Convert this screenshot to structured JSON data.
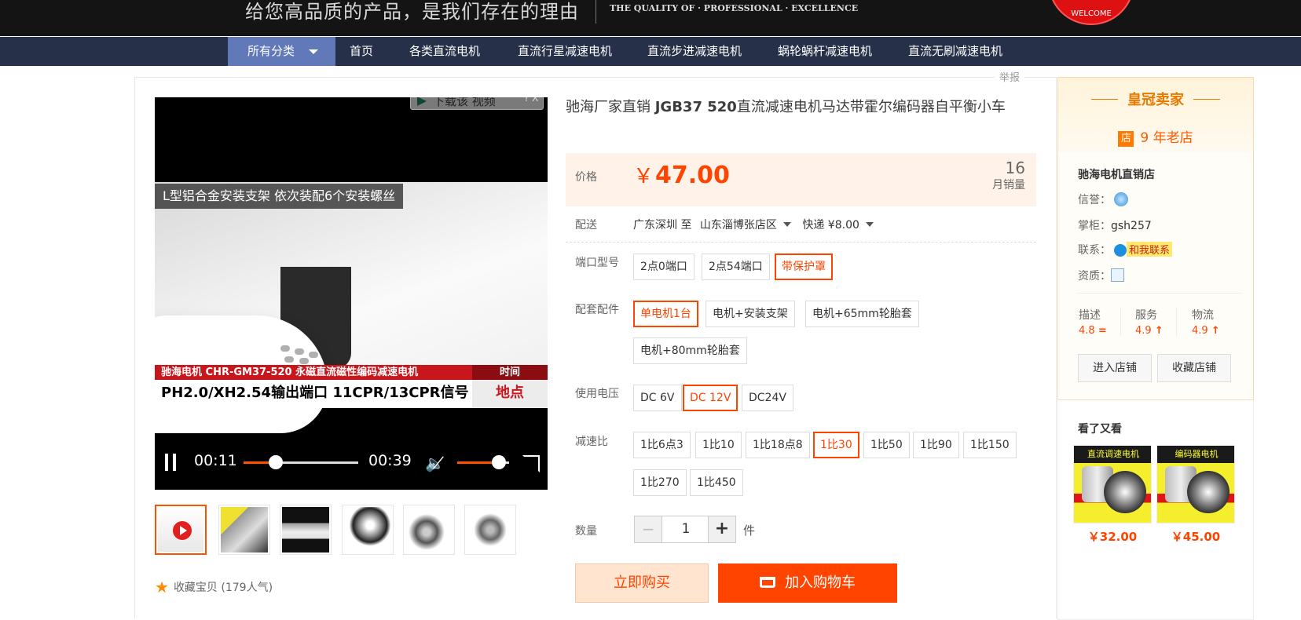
{
  "banner": {
    "slogan": "给您高品质的产品，是我们存在的理由",
    "motto": "THE QUALITY OF · PROFESSIONAL · EXCELLENCE",
    "welcome": "WELCOME"
  },
  "nav": {
    "all_categories": "所有分类",
    "items": [
      "首页",
      "各类直流电机",
      "直流行星减速电机",
      "直流步进减速电机",
      "蜗轮蜗杆减速电机",
      "直流无刷减速电机"
    ]
  },
  "report": "举报",
  "video": {
    "download_label": "下载该 视频",
    "download_close": "? X",
    "caption": "L型铝合金安装支架 依次装配6个安装螺丝",
    "red_bar_text": "驰海电机 CHR-GM37-520 永磁直流磁性编码减速电机",
    "red_bar_right": "时间",
    "white_bar_text": "PH2.0/XH2.54输出端口 11CPR/13CPR信号",
    "white_bar_right": "地点",
    "current_time": "00:11",
    "duration": "00:39",
    "progress": 0.28,
    "volume": 0.8
  },
  "favorite": {
    "label": "收藏宝贝",
    "count": "(179人气)"
  },
  "product": {
    "title_pre": "驰海厂家直销 ",
    "title_bold": "JGB37 520",
    "title_post": "直流减速电机马达带霍尔编码器自平衡小车",
    "price_label": "价格",
    "currency": "￥",
    "price": "47.00",
    "monthly_sales": "16",
    "monthly_sales_label": "月销量",
    "shipping_label": "配送",
    "ship_from": "广东深圳 至",
    "ship_to": "山东淄博张店区",
    "ship_fee": "快递 ¥8.00"
  },
  "options": {
    "port": {
      "label": "端口型号",
      "values": [
        "2点0端口",
        "2点54端口",
        "带保护罩"
      ],
      "selected": 2
    },
    "accessory": {
      "label": "配套配件",
      "values": [
        "单电机1台",
        "电机+安装支架",
        "电机+65mm轮胎套",
        "电机+80mm轮胎套"
      ],
      "selected": 0
    },
    "voltage": {
      "label": "使用电压",
      "values": [
        "DC 6V",
        "DC 12V",
        "DC24V"
      ],
      "selected": 1
    },
    "ratio": {
      "label": "减速比",
      "values": [
        "1比6点3",
        "1比10",
        "1比18点8",
        "1比30",
        "1比50",
        "1比90",
        "1比150",
        "1比270",
        "1比450"
      ],
      "selected": 3
    }
  },
  "quantity": {
    "label": "数量",
    "minus": "−",
    "value": "1",
    "plus": "+",
    "unit": "件"
  },
  "actions": {
    "buy_now": "立即购买",
    "add_to_cart": "加入购物车"
  },
  "seller": {
    "crown": "皇冠卖家",
    "age_icon": "店",
    "age": "9 年老店",
    "shop_name": "驰海电机直销店",
    "credit_label": "信誉：",
    "keeper_label": "掌柜：",
    "keeper": "gsh257",
    "contact_label": "联系：",
    "contact_btn": "和我联系",
    "qualification_label": "资质：",
    "scores": [
      {
        "label": "描述",
        "value": "4.8",
        "trend": "="
      },
      {
        "label": "服务",
        "value": "4.9",
        "trend": "↑"
      },
      {
        "label": "物流",
        "value": "4.9",
        "trend": "↑"
      }
    ],
    "enter_shop": "进入店铺",
    "fav_shop": "收藏店铺"
  },
  "also_viewed": {
    "title": "看了又看",
    "items": [
      {
        "tag": "直流调速电机",
        "price": "￥32.00"
      },
      {
        "tag": "编码器电机",
        "price": "￥45.00"
      }
    ]
  },
  "colors": {
    "accent": "#ff4400",
    "nav_bg": "#273049",
    "nav_active": "#6179b8"
  }
}
